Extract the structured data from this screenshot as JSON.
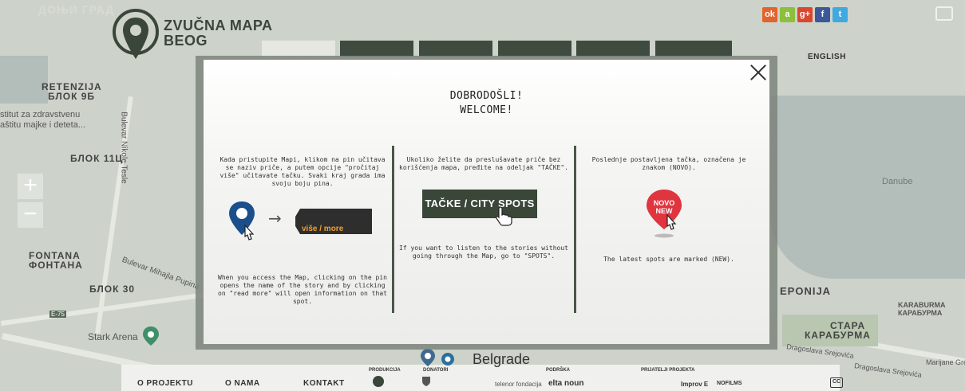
{
  "map": {
    "labels": {
      "retenzija_1": "RETENZIJA",
      "retenzija_2": "БЛОК 9Б",
      "institut_1": "stitut za zdravstvenu",
      "institut_2": "aštitu majke i deteta...",
      "bulevar_nikole": "Bulevar Nikole Tesle",
      "blok11": "БЛОК 11Ц",
      "fontana_1": "FONTANA",
      "fontana_2": "ФОНТАНА",
      "bulevar_mihaila": "Bulevar Mihajla Pupina",
      "blok30": "БЛОК 30",
      "stark": "Stark Arena",
      "danube": "Danube",
      "eponija": "EPONIJA",
      "karaburma_1": "KARABURMA",
      "karaburma_2": "КАРАБУРМА",
      "stara_1": "СТАРА",
      "stara_2": "КАРАБУРМА",
      "dragoslava_1": "Dragoslava Srejovića",
      "dragoslava_2": "Dragoslava Srejovića",
      "marijane": "Marijane Gre",
      "donji_grad": "ДОЊИ ГРАД",
      "e75": "E-75"
    },
    "zoom_in": "+",
    "zoom_out": "−"
  },
  "header": {
    "logo_line1": "ZVUČNA MAPA",
    "logo_line2": "BEOG",
    "language": "ENGLISH",
    "social": [
      "ok",
      "a",
      "g+",
      "f",
      "t"
    ]
  },
  "modal": {
    "title_line1": "DOBRODOŠLI!",
    "title_line2": "WELCOME!",
    "col1_sr": "Kada pristupite Mapi, klikom na pin učitava se naziv priče, a putem opcije \"pročitaj više\" učitavate tačku. Svaki kraj grada ima svoju boju pina.",
    "col1_more": "više / more",
    "col1_en": "When you access the Map, clicking on the pin opens the name of the story and by clicking on \"read more\" will open information on that spot.",
    "col2_sr": "Ukoliko želite da preslušavate priče bez korišćenja mapa, pređite na odeljak \"TAČKE\".",
    "col2_button": "TAČKE / CITY SPOTS",
    "col2_en": "If you want to listen to the stories without going through the Map, go to \"SPOTS\".",
    "col3_sr": "Poslednje postavljena tačka, označena je znakom (NOVO).",
    "col3_new_1": "NOVO",
    "col3_new_2": "NEW",
    "col3_en": "The latest spots are marked (NEW)."
  },
  "footer": {
    "o_projektu": "O PROJEKTU",
    "o_nama": "O NAMA",
    "kontakt": "KONTAKT",
    "produkcija": "PRODUKCIJA",
    "donatori": "DONATORI",
    "podrska": "PODRŠKA",
    "prijatelji": "PRIJATELJI PROJEKTA",
    "belgrade": "Belgrade",
    "telenor": "telenor fondacija",
    "nula": "elta noun",
    "improve": "Improv E",
    "nofilm": "NOFILMS",
    "cc": "CC"
  },
  "colors": {
    "accent_dark": "#394638",
    "pin_blue": "#1a4f8c",
    "pin_red": "#e0343f",
    "more_orange": "#f0a030"
  }
}
